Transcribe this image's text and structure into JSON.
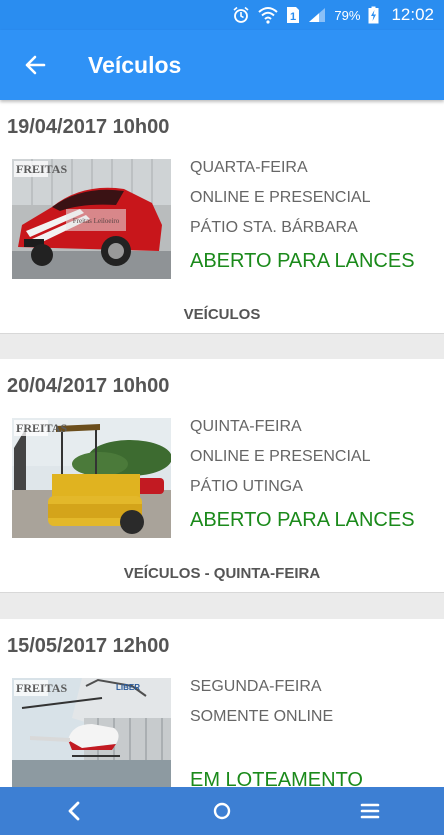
{
  "status_bar": {
    "battery_percent": "79%",
    "sim_number": "1",
    "time": "12:02",
    "icons": [
      "alarm-icon",
      "wifi-icon",
      "sim-icon",
      "signal-icon",
      "battery-charging-icon"
    ]
  },
  "app_bar": {
    "title": "Veículos",
    "back_icon": "arrow-back-icon",
    "background": "#2f92f6"
  },
  "colors": {
    "status_open": "#1b8a1b",
    "status_bar": "#2a8df0",
    "nav_bar": "#3d7fd3"
  },
  "auctions": [
    {
      "date": "19/04/2017 10h00",
      "weekday": "QUARTA-FEIRA",
      "mode": "ONLINE E PRESENCIAL",
      "location": "PÁTIO STA. BÁRBARA",
      "status": "ABERTO PARA LANCES",
      "category": "VEÍCULOS",
      "image_label": "red-camaro-photo",
      "watermark": "Freitas Leiloeiro Oficial"
    },
    {
      "date": "20/04/2017 10h00",
      "weekday": "QUINTA-FEIRA",
      "mode": "ONLINE E PRESENCIAL",
      "location": "PÁTIO UTINGA",
      "status": "ABERTO PARA LANCES",
      "category": "VEÍCULOS - QUINTA-FEIRA",
      "image_label": "road-roller-photo",
      "watermark": "Freitas Leiloeiro Oficial"
    },
    {
      "date": "15/05/2017 12h00",
      "weekday": "SEGUNDA-FEIRA",
      "mode": "SOMENTE ONLINE",
      "location": "",
      "status": "EM LOTEAMENTO",
      "category": "",
      "image_label": "helicopter-photo",
      "watermark": "Freitas Leiloeiro Oficial"
    }
  ],
  "nav_bar": {
    "icons": [
      "nav-back-icon",
      "nav-home-icon",
      "nav-menu-icon"
    ]
  }
}
